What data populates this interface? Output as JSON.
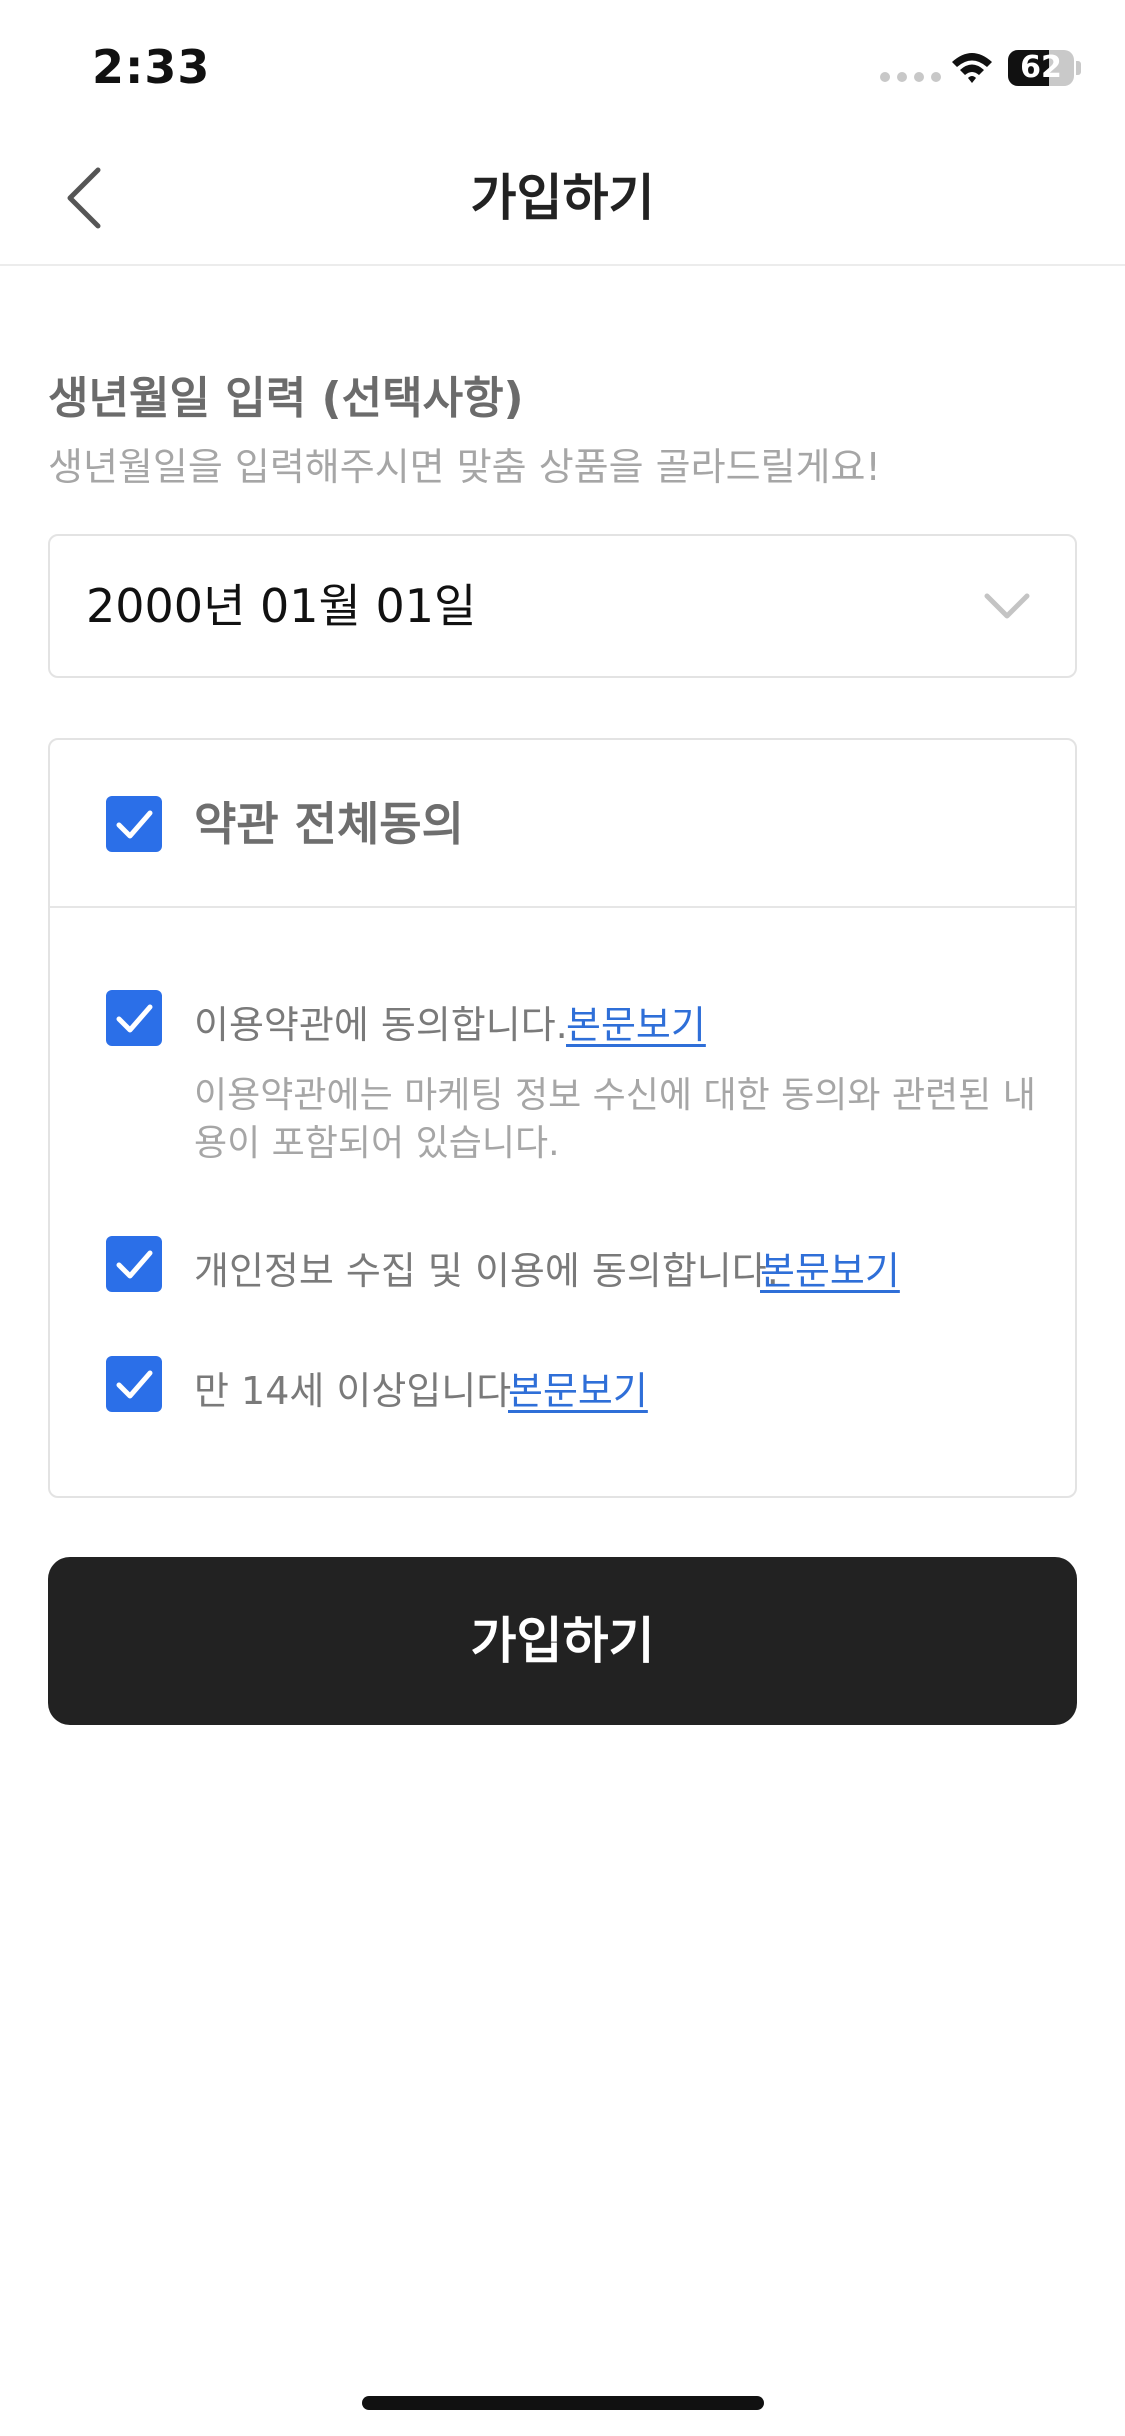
{
  "status_bar": {
    "time": "2:33",
    "battery_level": "62",
    "battery_fraction": 0.62,
    "icons": [
      "signal-dots-icon",
      "wifi-icon",
      "battery-icon"
    ]
  },
  "header": {
    "title": "가입하기",
    "back_icon": "chevron-left-icon"
  },
  "birth_date": {
    "title": "생년월일 입력 (선택사항)",
    "subtitle": "생년월일을 입력해주시면 맞춤 상품을 골라드릴게요!",
    "selected_value": "2000년 01월 01일",
    "dropdown_icon": "chevron-down-icon"
  },
  "agreements": {
    "all": {
      "label": "약관 전체동의",
      "checked": true
    },
    "items": [
      {
        "label": "이용약관에 동의합니다.",
        "link": "본문보기",
        "checked": true,
        "description_line1": "이용약관에는 마케팅 정보 수신에 대한 동의와 관련된 내",
        "description_line2": "용이 포함되어 있습니다."
      },
      {
        "label": "개인정보 수집 및 이용에 동의합니다.",
        "link": "본문보기",
        "checked": true
      },
      {
        "label": "만 14세 이상입니다",
        "link": "본문보기",
        "checked": true
      }
    ]
  },
  "submit": {
    "label": "가입하기"
  },
  "colors": {
    "accent_blue": "#2b6fe8",
    "link_blue": "#2f6fd8",
    "button_dark": "#222222",
    "border": "#e3e3e3"
  }
}
